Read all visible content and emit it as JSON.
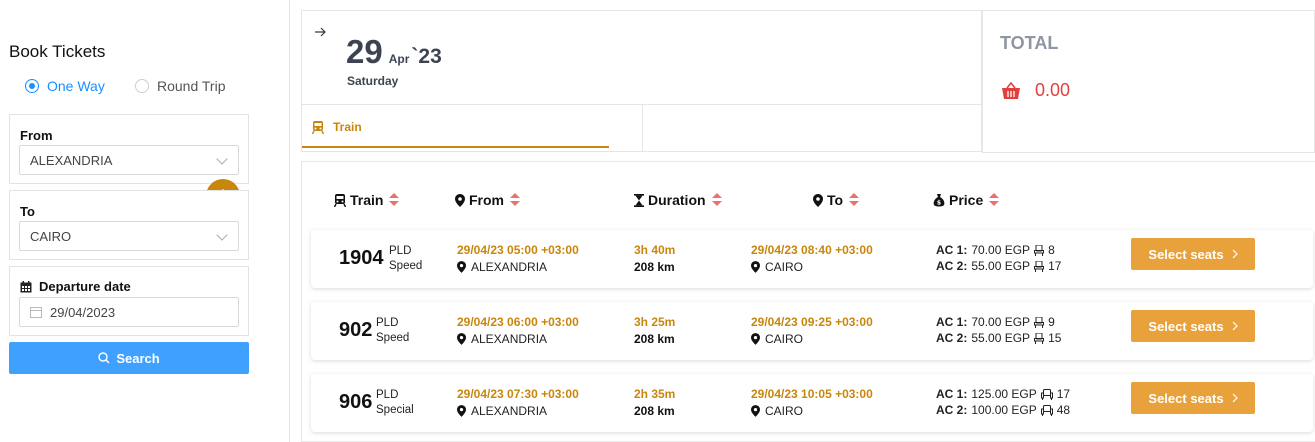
{
  "sidebar": {
    "title": "Book Tickets",
    "trip_options": [
      {
        "label": "One Way",
        "selected": true
      },
      {
        "label": "Round Trip",
        "selected": false
      }
    ],
    "from": {
      "label": "From",
      "value": "ALEXANDRIA"
    },
    "to": {
      "label": "To",
      "value": "CAIRO"
    },
    "departure": {
      "label": "Departure date",
      "value": "29/04/2023"
    },
    "search_label": "Search"
  },
  "header": {
    "day": "29",
    "month": "Apr",
    "year": "`23",
    "weekday": "Saturday",
    "tab_label": "Train",
    "total_label": "TOTAL",
    "total_value": "0.00"
  },
  "table": {
    "columns": [
      "Train",
      "From",
      "Duration",
      "To",
      "Price"
    ],
    "rows": [
      {
        "number": "1904",
        "line": "PLD",
        "category": "Speed",
        "dep_time": "29/04/23 05:00 +03:00",
        "dep_station": "ALEXANDRIA",
        "duration": "3h 40m",
        "distance": "208 km",
        "arr_time": "29/04/23 08:40 +03:00",
        "arr_station": "CAIRO",
        "price1_class": "AC 1:",
        "price1_value": "70.00 EGP",
        "price1_seats": "8",
        "price2_class": "AC 2:",
        "price2_value": "55.00 EGP",
        "price2_seats": "17",
        "button": "Select seats"
      },
      {
        "number": "902",
        "line": "PLD",
        "category": "Speed",
        "dep_time": "29/04/23 06:00 +03:00",
        "dep_station": "ALEXANDRIA",
        "duration": "3h 25m",
        "distance": "208 km",
        "arr_time": "29/04/23 09:25 +03:00",
        "arr_station": "CAIRO",
        "price1_class": "AC 1:",
        "price1_value": "70.00 EGP",
        "price1_seats": "9",
        "price2_class": "AC 2:",
        "price2_value": "55.00 EGP",
        "price2_seats": "15",
        "button": "Select seats"
      },
      {
        "number": "906",
        "line": "PLD",
        "category": "Special",
        "dep_time": "29/04/23 07:30 +03:00",
        "dep_station": "ALEXANDRIA",
        "duration": "2h 35m",
        "distance": "208 km",
        "arr_time": "29/04/23 10:05 +03:00",
        "arr_station": "CAIRO",
        "price1_class": "AC 1:",
        "price1_value": "125.00 EGP",
        "price1_seats": "17",
        "price2_class": "AC 2:",
        "price2_value": "100.00 EGP",
        "price2_seats": "48",
        "button": "Select seats"
      }
    ]
  },
  "colors": {
    "accent": "#c8860d",
    "primary": "#40a0ff",
    "button": "#e9a13b",
    "danger": "#e0413d"
  }
}
